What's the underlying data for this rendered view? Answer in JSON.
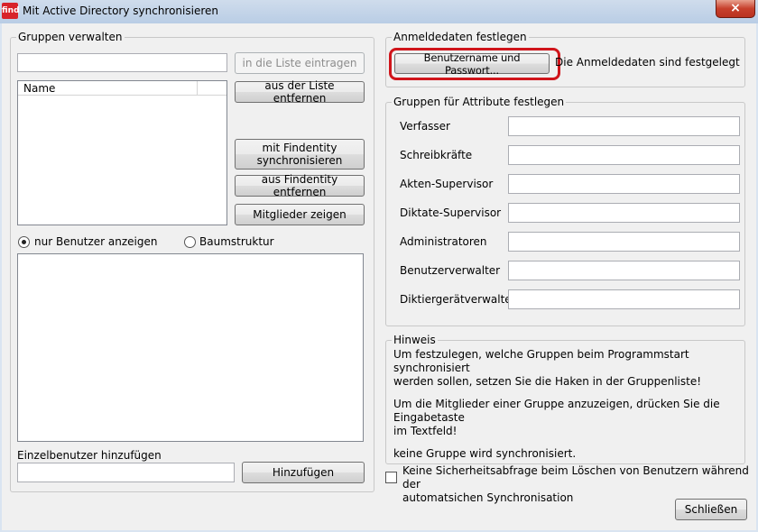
{
  "window": {
    "icon_text": "find",
    "title": "Mit Active Directory synchronisieren",
    "close_symbol": "×"
  },
  "groups": {
    "legend": "Gruppen verwalten",
    "input_value": "",
    "add_to_list_label": "in die Liste eintragen",
    "remove_from_list_label": "aus der Liste entfernen",
    "list_header_name": "Name",
    "sync_findentity_label_line1": "mit Findentity",
    "sync_findentity_label_line2": "synchronisieren",
    "remove_findentity_label": "aus Findentity entfernen",
    "show_members_label": "Mitglieder zeigen",
    "radio_users_label": "nur Benutzer anzeigen",
    "radio_tree_label": "Baumstruktur",
    "single_user_label": "Einzelbenutzer hinzufügen",
    "single_user_value": "",
    "add_button_label": "Hinzufügen"
  },
  "credentials": {
    "legend": "Anmeldedaten festlegen",
    "button_label": "Benutzername und Passwort...",
    "status_text": "Die Anmeldedaten sind festgelegt"
  },
  "attributes": {
    "legend": "Gruppen für Attribute festlegen",
    "fields": [
      {
        "label": "Verfasser",
        "value": ""
      },
      {
        "label": "Schreibkräfte",
        "value": ""
      },
      {
        "label": "Akten-Supervisor",
        "value": ""
      },
      {
        "label": "Diktate-Supervisor",
        "value": ""
      },
      {
        "label": "Administratoren",
        "value": ""
      },
      {
        "label": "Benutzerverwalter",
        "value": ""
      },
      {
        "label": "Diktiergerätverwalter",
        "value": ""
      }
    ]
  },
  "hint": {
    "legend": "Hinweis",
    "para1_line1": "Um festzulegen, welche Gruppen beim Programmstart synchronisiert",
    "para1_line2": "werden sollen, setzen Sie die Haken in der Gruppenliste!",
    "para2_line1": "Um die Mitglieder einer Gruppe anzuzeigen, drücken Sie die Eingabetaste",
    "para2_line2": "im Textfeld!",
    "para3": "keine Gruppe wird synchronisiert."
  },
  "confirm_checkbox": {
    "checked": false,
    "label_line1": "Keine Sicherheitsabfrage beim Löschen von Benutzern während der",
    "label_line2": "automatsichen Synchronisation"
  },
  "close_button_label": "Schließen",
  "colors": {
    "highlight": "#d0151b",
    "title_close": "#c7402c"
  }
}
